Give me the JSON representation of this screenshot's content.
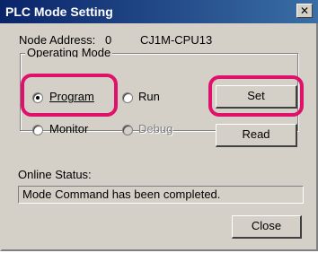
{
  "window": {
    "title": "PLC Mode Setting",
    "close_glyph": "✕"
  },
  "node": {
    "address_label": "Node Address:",
    "address_value": "0",
    "model": "CJ1M-CPU13"
  },
  "operating_mode": {
    "group_title": "Operating Mode",
    "options": [
      {
        "label": "Program",
        "selected": true,
        "enabled": true
      },
      {
        "label": "Run",
        "selected": false,
        "enabled": true
      },
      {
        "label": "Monitor",
        "selected": false,
        "enabled": true
      },
      {
        "label": "Debug",
        "selected": false,
        "enabled": false
      }
    ]
  },
  "buttons": {
    "set": "Set",
    "read": "Read",
    "close": "Close"
  },
  "online_status": {
    "label": "Online Status:",
    "message": "Mode Command has been completed."
  },
  "colors": {
    "highlight": "#e0116b",
    "titlebar": "#0a246a"
  }
}
